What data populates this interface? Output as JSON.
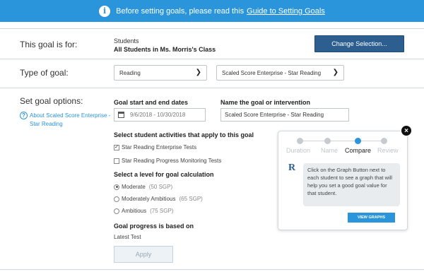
{
  "banner": {
    "message": "Before setting goals, please read this",
    "link": "Guide to Setting Goals",
    "icon": "info-icon"
  },
  "goal_for": {
    "label": "This goal is for:",
    "line1": "Students",
    "line2": "All Students in Ms. Morris's Class",
    "change_button": "Change Selection..."
  },
  "goal_type": {
    "label": "Type of goal:",
    "subject": "Reading",
    "assessment": "Scaled Score Enterprise - Star Reading"
  },
  "options": {
    "label": "Set goal options:",
    "about_link": "About Scaled Score Enterprise - Star Reading",
    "dates_heading": "Goal start and end dates",
    "dates_value": "9/6/2018 - 10/30/2018",
    "name_heading": "Name the goal or intervention",
    "name_value": "Scaled Score Enterprise - Star Reading",
    "activities_heading": "Select student activities that apply to this goal",
    "activities": [
      {
        "label": "Star Reading Enterprise Tests",
        "checked": true
      },
      {
        "label": "Star Reading Progress Monitoring Tests",
        "checked": false
      }
    ],
    "level_heading": "Select a level for goal calculation",
    "levels": [
      {
        "label": "Moderate",
        "sgp": "(50 SGP)",
        "selected": true
      },
      {
        "label": "Moderately Ambitious",
        "sgp": "(65 SGP)",
        "selected": false
      },
      {
        "label": "Ambitious",
        "sgp": "(75 SGP)",
        "selected": false
      }
    ],
    "progress_heading": "Goal progress is based on",
    "progress_value": "Latest Test",
    "apply_button": "Apply"
  },
  "popup": {
    "steps": [
      "Duration",
      "Name",
      "Compare",
      "Review"
    ],
    "active_step": "Compare",
    "message": "Click on the Graph Button next to each student to see a graph that will help you set a good goal value for that student.",
    "button": "VIEW GRAPHS",
    "close": "×",
    "logo": "R"
  },
  "colors": {
    "banner": "#2b95db",
    "primary_button": "#2c5f8f"
  }
}
